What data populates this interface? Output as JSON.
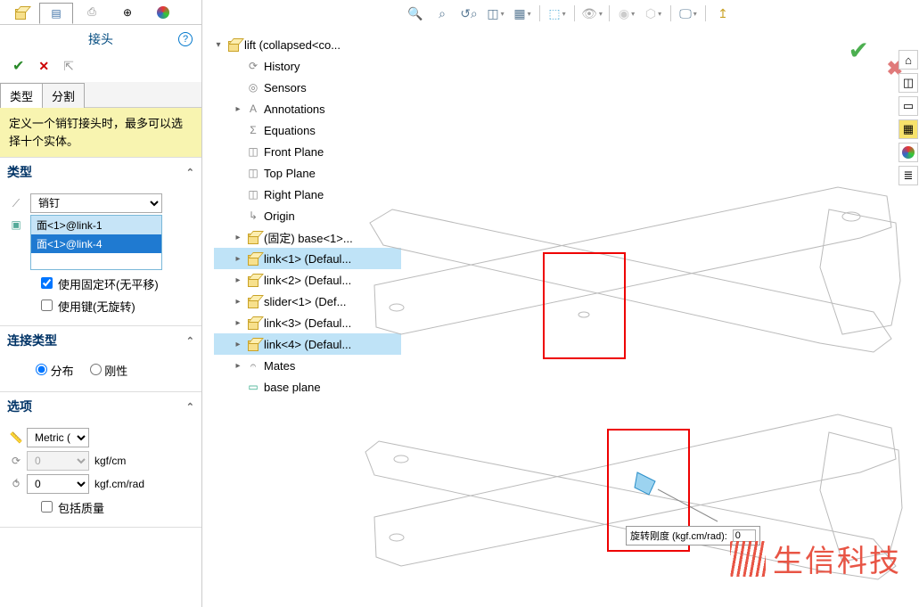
{
  "panel": {
    "title": "接头",
    "tabs": [
      "类型",
      "分割"
    ],
    "hint": "定义一个销钉接头时，最多可以选择十个实体。",
    "sections": {
      "type": {
        "title": "类型",
        "joint_type": "销钉",
        "selections": [
          "面<1>@link-1",
          "面<1>@link-4"
        ],
        "use_fixed_ring": "使用固定环(无平移)",
        "use_key": "使用键(无旋转)"
      },
      "conn": {
        "title": "连接类型",
        "opt1": "分布",
        "opt2": "刚性"
      },
      "options": {
        "title": "选项",
        "metric": "Metric (G)",
        "stiffness_val": "0",
        "stiffness_unit": "kgf/cm",
        "rot_val": "0",
        "rot_unit": "kgf.cm/rad",
        "include_mass": "包括质量"
      }
    }
  },
  "tree": {
    "root": "lift  (collapsed<co...",
    "items": [
      {
        "icon": "history",
        "label": "History"
      },
      {
        "icon": "sensors",
        "label": "Sensors"
      },
      {
        "icon": "annot",
        "label": "Annotations",
        "expand": true
      },
      {
        "icon": "eq",
        "label": "Equations"
      },
      {
        "icon": "plane",
        "label": "Front Plane"
      },
      {
        "icon": "plane",
        "label": "Top Plane"
      },
      {
        "icon": "plane",
        "label": "Right Plane"
      },
      {
        "icon": "origin",
        "label": "Origin"
      },
      {
        "icon": "part",
        "label": "(固定) base<1>...",
        "expand": true
      },
      {
        "icon": "part",
        "label": "link<1> (Defaul...",
        "expand": true,
        "hl": true
      },
      {
        "icon": "part",
        "label": "link<2> (Defaul...",
        "expand": true
      },
      {
        "icon": "part",
        "label": "slider<1> (Def...",
        "expand": true
      },
      {
        "icon": "part",
        "label": "link<3> (Defaul...",
        "expand": true
      },
      {
        "icon": "part",
        "label": "link<4> (Defaul...",
        "expand": true,
        "hl": true
      },
      {
        "icon": "mates",
        "label": "Mates",
        "expand": true
      },
      {
        "icon": "plane2",
        "label": "base plane"
      }
    ]
  },
  "callout": {
    "label": "旋转刚度 (kgf.cm/rad):",
    "value": "0"
  },
  "watermark": "生信科技"
}
